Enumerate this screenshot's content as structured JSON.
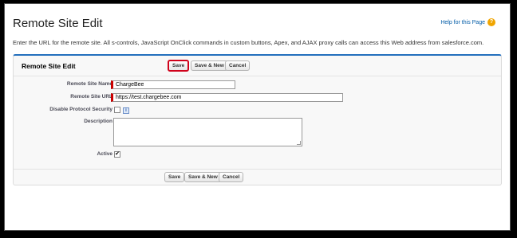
{
  "page": {
    "title": "Remote Site Edit",
    "help_link": "Help for this Page",
    "help_icon": "help-icon",
    "description": "Enter the URL for the remote site. All s-controls, JavaScript OnClick commands in custom buttons, Apex, and AJAX proxy calls can access this Web address from salesforce.com."
  },
  "block": {
    "title": "Remote Site Edit",
    "buttons": {
      "save": "Save",
      "save_new": "Save & New",
      "cancel": "Cancel"
    },
    "fields": {
      "name": {
        "label": "Remote Site Name",
        "value": "ChargeBee"
      },
      "url": {
        "label": "Remote Site URL",
        "value": "https://test.chargebee.com"
      },
      "disable_protocol": {
        "label": "Disable Protocol Security",
        "checked": false,
        "info_icon": "i"
      },
      "description": {
        "label": "Description",
        "value": ""
      },
      "active": {
        "label": "Active",
        "checked": true,
        "mark": "✔"
      }
    },
    "footer_buttons": {
      "save": "Save",
      "save_new": "Save & New",
      "cancel": "Cancel"
    }
  },
  "colors": {
    "accent_top": "#236fbd",
    "required": "#cc0000",
    "highlight": "#d0021b"
  }
}
